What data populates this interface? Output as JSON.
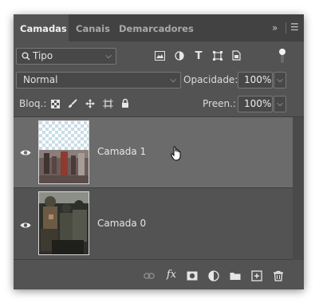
{
  "tabs": [
    {
      "label": "Camadas",
      "active": true
    },
    {
      "label": "Canais",
      "active": false
    },
    {
      "label": "Demarcadores",
      "active": false
    }
  ],
  "tabbar_icons": [
    "double-chevron-right-icon",
    "hamburger-menu-icon"
  ],
  "filter": {
    "label": "Tipo",
    "icons": [
      "image-filter-icon",
      "adjustment-filter-icon",
      "type-filter-icon",
      "shape-filter-icon",
      "smart-object-filter-icon",
      "filter-toggle-icon"
    ]
  },
  "blend": {
    "mode": "Normal",
    "opacity_label": "Opacidade:",
    "opacity_value": "100%"
  },
  "lock": {
    "label": "Bloq.:",
    "icons": [
      "lock-transparent-pixels-icon",
      "lock-image-pixels-icon",
      "lock-position-icon",
      "lock-artboard-icon",
      "lock-all-icon"
    ],
    "fill_label": "Preen.:",
    "fill_value": "100%"
  },
  "layers": [
    {
      "name": "Camada 1",
      "selected": true,
      "visible": true
    },
    {
      "name": "Camada 0",
      "selected": false,
      "visible": true
    }
  ],
  "bottom_icons": [
    "link-layers-icon",
    "layer-style-fx-icon",
    "add-mask-icon",
    "adjustment-layer-icon",
    "new-group-icon",
    "new-layer-icon",
    "delete-layer-icon"
  ],
  "colors": {
    "panel": "#535353",
    "tabbar": "#424242",
    "selected_row": "#6b6b6b"
  }
}
